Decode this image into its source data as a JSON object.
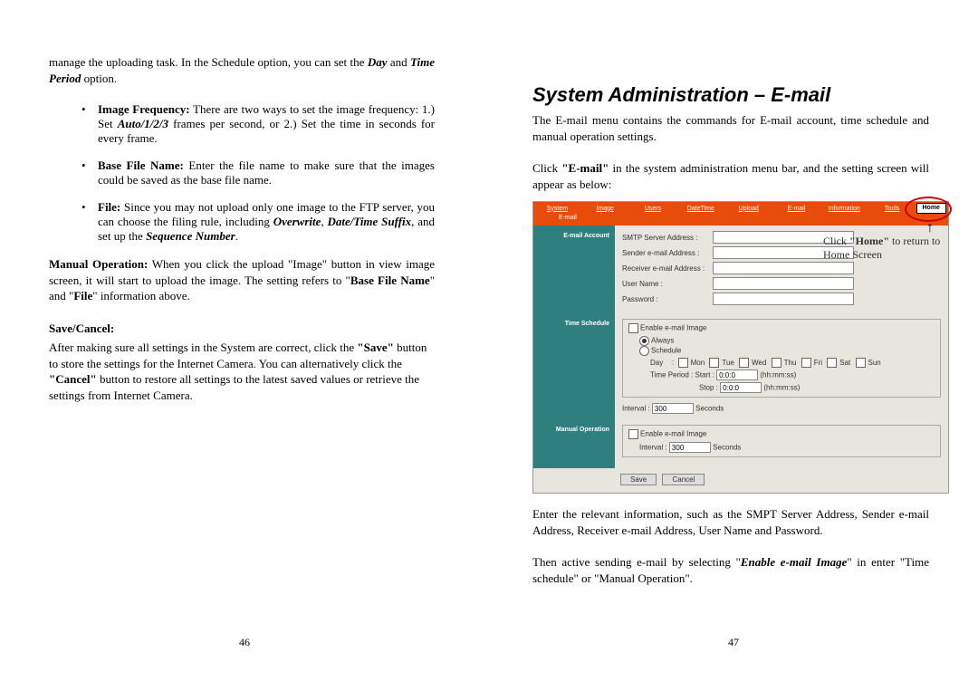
{
  "left": {
    "intro": "manage the uploading task.  In the Schedule option, you can set the ",
    "intro_bold_italic": "Day",
    "intro_mid": " and ",
    "intro_bold_italic2": "Time Period",
    "intro_end": " option.",
    "bullets": {
      "b1_label": "Image Frequency:",
      "b1_text_a": " There are two ways to set the image frequency: 1.) Set ",
      "b1_text_bi": "Auto/1/2/3",
      "b1_text_b": " frames per second, or 2.) Set the time in seconds for every frame.",
      "b2_label": "Base File Name:",
      "b2_text": " Enter the file name to make sure that the images could be saved as the base file name.",
      "b3_label": "File:",
      "b3_text_a": " Since you may not upload only one image to the FTP server, you can choose the filing rule, including ",
      "b3_bi1": "Overwrite",
      "b3_c1": ", ",
      "b3_bi2": "Date/Time Suffix",
      "b3_c2": ", and set up the ",
      "b3_bi3": "Sequence Number",
      "b3_c3": "."
    },
    "manual_label": "Manual Operation:",
    "manual_text_a": " When you click the upload \"Image\" button in view image screen, it will start to upload the image.  The setting refers to \"",
    "manual_b1": "Base File Name",
    "manual_text_b": "\" and \"",
    "manual_b2": "File",
    "manual_text_c": "\" information above.",
    "save_label": "Save/Cancel:",
    "save_text_a": "After making sure all settings in the System are correct, click the ",
    "save_q1": "\"Save\"",
    "save_text_b": " button to store the settings for the Internet Camera.  You can alternatively click the ",
    "save_q2": "\"Cancel\"",
    "save_text_c": " button to restore all settings to the latest saved values or retrieve the settings from Internet Camera.",
    "page_num": "46"
  },
  "right": {
    "title": "System Administration – E-mail",
    "p1": "The E-mail menu contains the commands for E-mail account, time schedule and manual operation settings.",
    "p2a": "Click ",
    "p2b": "\"E-mail\"",
    "p2c": " in the system administration menu bar, and the setting screen will appear as below:",
    "p3": "Enter the relevant information, such as the SMPT Server Address, Sender e-mail Address, Receiver e-mail Address, User Name and Password.",
    "p4a": "Then active sending e-mail by selecting \"",
    "p4b": "Enable e-mail Image",
    "p4c": "\" in enter \"Time schedule\" or \"Manual Operation\".",
    "page_num": "47",
    "callout_a": "Click ",
    "callout_b": "\"Home\"",
    "callout_c": " to return to Home Screen"
  },
  "ui": {
    "menu": {
      "system": "System",
      "image": "Image",
      "users": "Users",
      "datetime": "DateTime",
      "upload": "Upload",
      "email": "E-mail",
      "info": "Information",
      "tools": "Tools",
      "home": "Home"
    },
    "sub": "E-mail",
    "side": {
      "acct": "E-mail Account",
      "sched": "Time Schedule",
      "manual": "Manual Operation"
    },
    "form": {
      "smtp": "SMTP Server Address :",
      "sender": "Sender e-mail Address :",
      "receiver": "Receiver e-mail Address :",
      "user": "User Name :",
      "pass": "Password :",
      "enable": "Enable e-mail Image",
      "always": "Always",
      "schedule": "Schedule",
      "day": "Day",
      "mon": "Mon",
      "tue": "Tue",
      "wed": "Wed",
      "thu": "Thu",
      "fri": "Fri",
      "sat": "Sat",
      "sun": "Sun",
      "timeperiod": "Time Period :",
      "start": "Start :",
      "stop": "Stop :",
      "start_v": "0:0:0",
      "stop_v": "0:0:0",
      "hhmmss": "(hh:mm:ss)",
      "interval": "Interval :",
      "interval_v": "300",
      "seconds": "Seconds",
      "save": "Save",
      "cancel": "Cancel"
    }
  }
}
